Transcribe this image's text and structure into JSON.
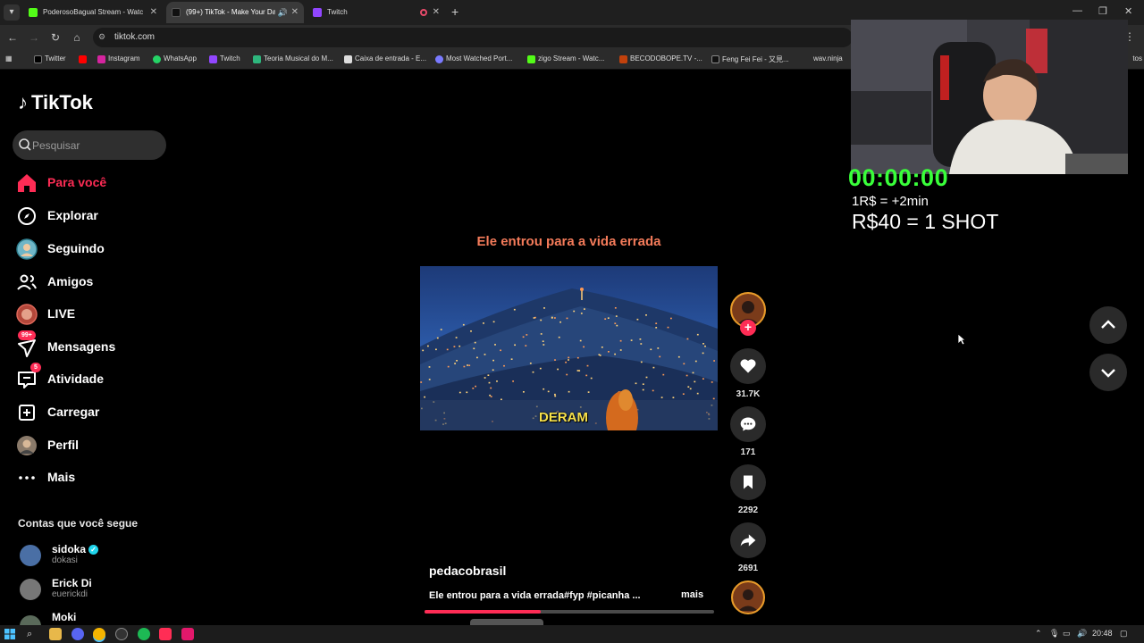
{
  "browser": {
    "tabs": [
      {
        "title": "PoderosoBagual Stream - Watc",
        "active": false
      },
      {
        "title": "(99+) TikTok - Make Your Da",
        "active": true
      },
      {
        "title": "Twitch",
        "active": false
      }
    ],
    "url": "tiktok.com",
    "bookmarks": [
      "Twitter",
      "Instagram",
      "WhatsApp",
      "Twitch",
      "Teoria Musical do M...",
      "Caixa de entrada - E...",
      "Most Watched Port...",
      "zigo Stream - Watc...",
      "BECODOBOPE.TV -...",
      "Feng Fei Fei - 又見...",
      "wav.ninja"
    ],
    "bookmarks_right": "tos"
  },
  "tiktok": {
    "logo_text": "TikTok",
    "search_placeholder": "Pesquisar",
    "nav": [
      {
        "label": "Para você",
        "icon": "home-icon",
        "active": true
      },
      {
        "label": "Explorar",
        "icon": "compass-icon"
      },
      {
        "label": "Seguindo",
        "icon": "following-avatar-icon"
      },
      {
        "label": "Amigos",
        "icon": "friends-icon"
      },
      {
        "label": "LIVE",
        "icon": "live-avatar-icon"
      },
      {
        "label": "Mensagens",
        "icon": "messages-icon",
        "badge": "99+"
      },
      {
        "label": "Atividade",
        "icon": "activity-icon",
        "badge": "5"
      },
      {
        "label": "Carregar",
        "icon": "upload-icon"
      },
      {
        "label": "Perfil",
        "icon": "profile-avatar-icon"
      },
      {
        "label": "Mais",
        "icon": "more-dots-icon"
      }
    ],
    "following_title": "Contas que você segue",
    "following": [
      {
        "name": "sidoka",
        "username": "dokasi",
        "verified": true
      },
      {
        "name": "Erick Di",
        "username": "euerickdi",
        "verified": false
      },
      {
        "name": "Moki",
        "username": "",
        "verified": false
      }
    ],
    "video": {
      "title": "Ele entrou para a vida errada",
      "caption_overlay": "DERAM",
      "author": "pedacobrasil",
      "description": "Ele entrou para a vida errada#fyp #picanha ...",
      "more_label": "mais",
      "progress": 0.4
    },
    "actions": {
      "likes": "31.7K",
      "comments": "171",
      "saves": "2292",
      "shares": "2691"
    }
  },
  "stream_overlay": {
    "timer": "00:00:00",
    "rule_1": "1R$ = +2min",
    "rule_2": "R$40 = 1 SHOT"
  },
  "taskbar": {
    "time": "20:48"
  },
  "colors": {
    "tiktok_red": "#fe2c55",
    "timer_green": "#39ff3a",
    "title_orange": "#f47b5a"
  }
}
